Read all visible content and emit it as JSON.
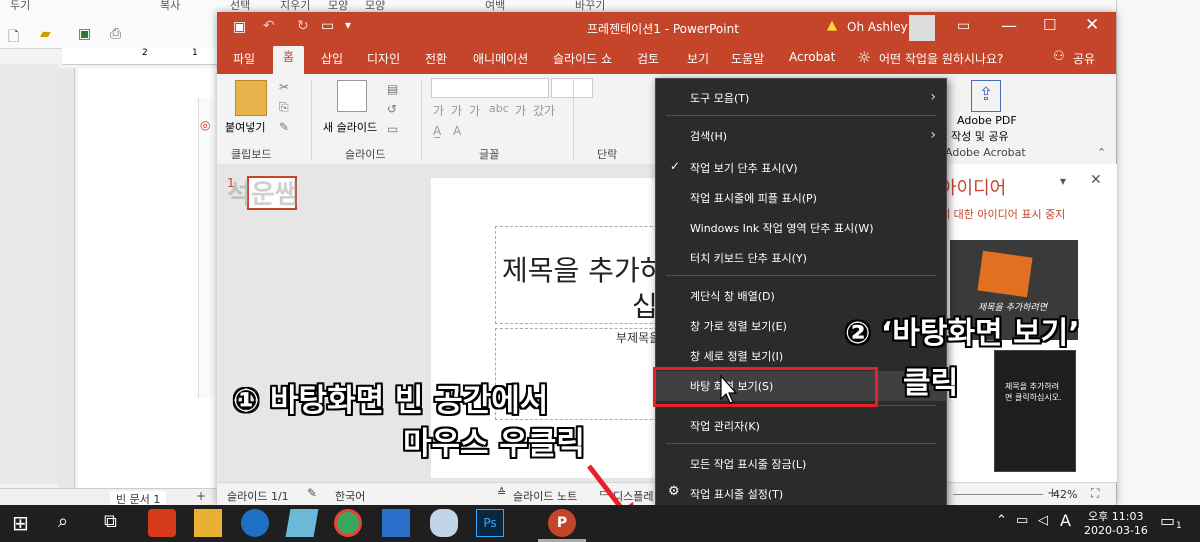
{
  "background_window": {
    "menu_labels": [
      "두기",
      "복사",
      "선택",
      "지우기",
      "모양",
      "모양",
      "여백",
      "바꾸기"
    ],
    "statusbar_text": "빈 문서 1",
    "ruler_marks": [
      "2",
      "1"
    ],
    "watermark": "석운쌤"
  },
  "ppt": {
    "title": "프레젠테이션1 - PowerPoint",
    "user": "Oh Ashley",
    "tabs": [
      "파일",
      "홈",
      "삽입",
      "디자인",
      "전환",
      "애니메이션",
      "슬라이드 쇼",
      "검토",
      "보기",
      "도움말",
      "Acrobat"
    ],
    "active_tab": "홈",
    "tell_me": "어떤 작업을 원하시나요?",
    "share": "공유",
    "ribbon": {
      "paste_label": "붙여넣기",
      "new_slide_label": "새 슬라이드",
      "groups": [
        "클립보드",
        "슬라이드",
        "글꼴",
        "단락"
      ],
      "font_buttons": [
        "가",
        "가",
        "가",
        "abc",
        "가",
        "갔가"
      ],
      "adobe_pdf": "Adobe PDF",
      "adobe_pdf_sub": "작성 및 공유",
      "adobe_group": "Adobe Acrobat"
    },
    "thumb_number": "1",
    "slide": {
      "title_line1": "제목을 추가하려면",
      "title_line2": "십시오.",
      "subtitle": "부제목을 입력하십시오"
    },
    "ideas": {
      "title": "아이디어",
      "link": "에 대한 아이디어 표시 중지",
      "thumb1_text": "제목을 추가하려면",
      "thumb2_text": "제목을 추가하려면 클릭하십시오."
    },
    "status": {
      "slide_info": "슬라이드 1/1",
      "language": "한국어",
      "notes": "슬라이드 노트",
      "display": "디스플레",
      "zoom": "42%"
    }
  },
  "context_menu": {
    "items": [
      {
        "label": "도구 모음(T)",
        "submenu": true,
        "checked": false
      },
      {
        "label": "검색(H)",
        "submenu": true,
        "checked": false
      },
      {
        "label": "작업 보기 단추 표시(V)",
        "submenu": false,
        "checked": true
      },
      {
        "label": "작업 표시줄에 피플 표시(P)",
        "submenu": false,
        "checked": false
      },
      {
        "label": "Windows Ink 작업 영역 단추 표시(W)",
        "submenu": false,
        "checked": false
      },
      {
        "label": "터치 키보드 단추 표시(Y)",
        "submenu": false,
        "checked": false
      },
      {
        "label": "계단식 창 배열(D)",
        "submenu": false,
        "checked": false
      },
      {
        "label": "창 가로 정렬 보기(E)",
        "submenu": false,
        "checked": false
      },
      {
        "label": "창 세로 정렬 보기(I)",
        "submenu": false,
        "checked": false
      },
      {
        "label": "바탕 화면 보기(S)",
        "submenu": false,
        "checked": false,
        "highlighted": true
      },
      {
        "label": "작업 관리자(K)",
        "submenu": false,
        "checked": false
      },
      {
        "label": "모든 작업 표시줄 잠금(L)",
        "submenu": false,
        "checked": false
      },
      {
        "label": "작업 표시줄 설정(T)",
        "submenu": false,
        "checked": false,
        "gear": true
      }
    ],
    "highlight_color": "#e8202a"
  },
  "annotations": {
    "step1_line1": "① 바탕화면 빈 공간에서",
    "step1_line2": "마우스 우클릭",
    "step2_line1": "② ‘바탕화면 보기’",
    "step2_line2": "클릭",
    "arrow_color": "#e8202a"
  },
  "taskbar": {
    "time": "오후 11:03",
    "date": "2020-03-16",
    "ime": "A",
    "notification_count": "1"
  },
  "colors": {
    "ppt_accent": "#c5452a",
    "menu_bg": "#2b2b2b",
    "taskbar_bg": "#1f1f1f"
  }
}
